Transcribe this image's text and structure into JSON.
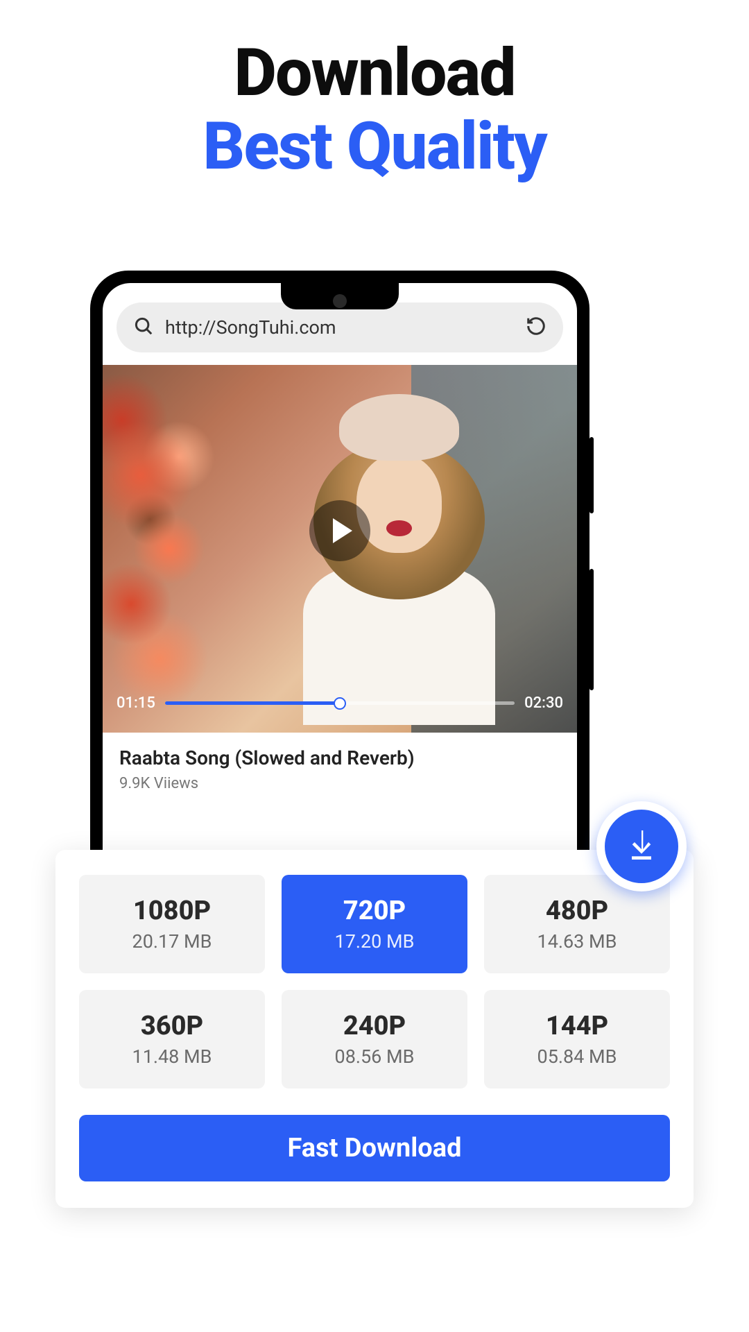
{
  "headline": {
    "line1": "Download",
    "line2": "Best Quality"
  },
  "urlBar": {
    "url": "http://SongTuhi.com"
  },
  "player": {
    "currentTime": "01:15",
    "duration": "02:30"
  },
  "video": {
    "title": "Raabta Song (Slowed and Reverb)",
    "views": "9.9K Viiews"
  },
  "quality": [
    {
      "label": "1080P",
      "size": "20.17 MB",
      "selected": false
    },
    {
      "label": "720P",
      "size": "17.20 MB",
      "selected": true
    },
    {
      "label": "480P",
      "size": "14.63 MB",
      "selected": false
    },
    {
      "label": "360P",
      "size": "11.48 MB",
      "selected": false
    },
    {
      "label": "240P",
      "size": "08.56 MB",
      "selected": false
    },
    {
      "label": "144P",
      "size": "05.84 MB",
      "selected": false
    }
  ],
  "actions": {
    "download": "Fast Download"
  }
}
